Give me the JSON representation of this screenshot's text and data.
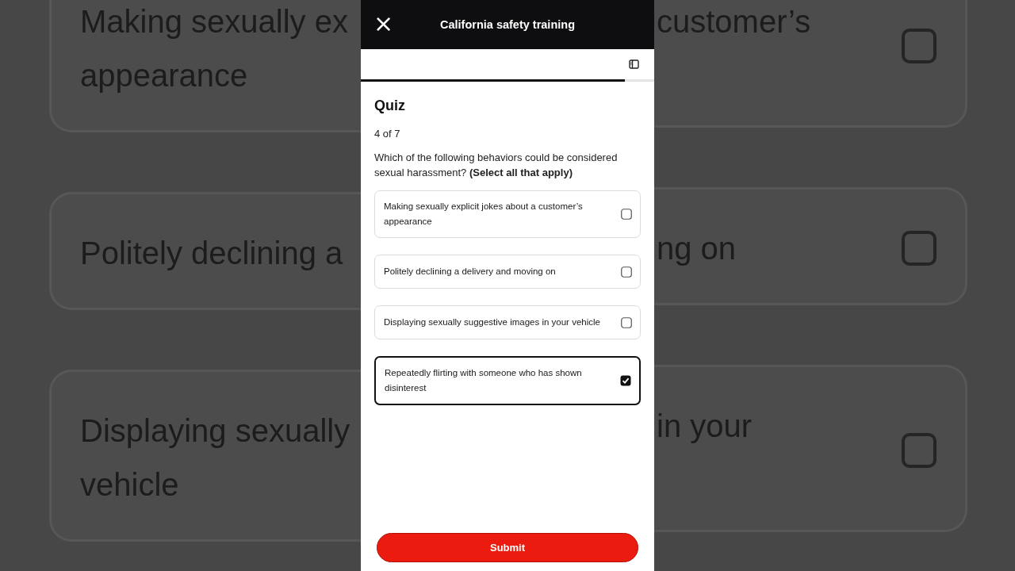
{
  "background": {
    "cards": [
      {
        "left_lines": [
          "Making sexually ex",
          "appearance"
        ],
        "right_lines": [
          "customer’s"
        ],
        "checked": false
      },
      {
        "left_lines": [
          "Politely declining a"
        ],
        "right_lines": [
          "ng on"
        ],
        "checked": false
      },
      {
        "left_lines": [
          "Displaying sexually",
          "vehicle"
        ],
        "right_lines": [
          "in your"
        ],
        "checked": false
      }
    ]
  },
  "header": {
    "close": "×",
    "title": "California safety training"
  },
  "progress": {
    "level": 0.9
  },
  "quiz": {
    "title": "Quiz",
    "counter": "4 of 7",
    "question": "Which of the following behaviors could be considered sexual harassment? **(Select all that apply)**",
    "options": [
      {
        "label": "Making sexually explicit jokes about a customer’s appearance",
        "selected": false
      },
      {
        "label": "Politely declining a delivery and moving on",
        "selected": false
      },
      {
        "label": "Displaying sexually suggestive images in your vehicle",
        "selected": false
      },
      {
        "label": "Repeatedly flirting with someone who has shown disinterest",
        "selected": true
      }
    ]
  },
  "submit": "Submit"
}
